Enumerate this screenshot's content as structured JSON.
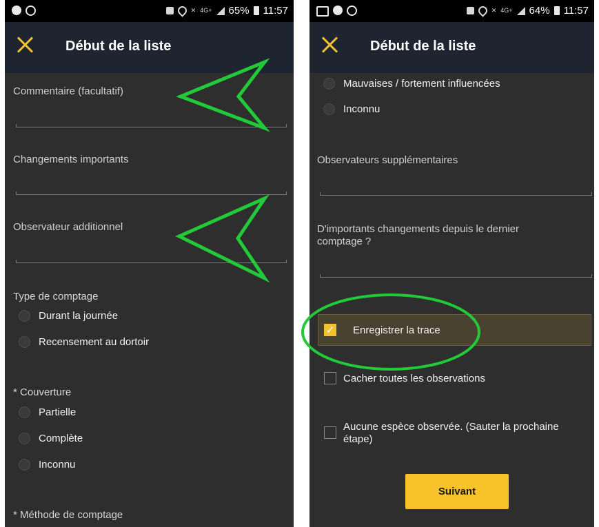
{
  "left": {
    "status": {
      "battery": "65%",
      "time": "11:57"
    },
    "title": "Début de la liste",
    "fields": {
      "comment": "Commentaire (facultatif)",
      "changes": "Changements importants",
      "observer": "Observateur additionnel"
    },
    "count_type": {
      "label": "Type de comptage",
      "options": [
        "Durant la journée",
        "Recensement au dortoir"
      ]
    },
    "coverage": {
      "label": "* Couverture",
      "options": [
        "Partielle",
        "Complète",
        "Inconnu"
      ]
    },
    "method_label": "* Méthode de comptage"
  },
  "right": {
    "status": {
      "battery": "64%",
      "time": "11:57"
    },
    "title": "Début de la liste",
    "options": [
      "Mauvaises / fortement influencées",
      "Inconnu"
    ],
    "fields": {
      "extra_observers": "Observateurs supplémentaires",
      "changes_question": "D'importants changements depuis le dernier comptage ?"
    },
    "checkboxes": {
      "record_track": "Enregistrer la trace",
      "hide_obs": "Cacher toutes les observations",
      "no_species": "Aucune espèce observée. (Sauter la prochaine étape)"
    },
    "next_button": "Suivant"
  },
  "colors": {
    "accent": "#f2c230",
    "appbar": "#1e2531",
    "background": "#2e2e2e",
    "annotation": "#22c938"
  }
}
